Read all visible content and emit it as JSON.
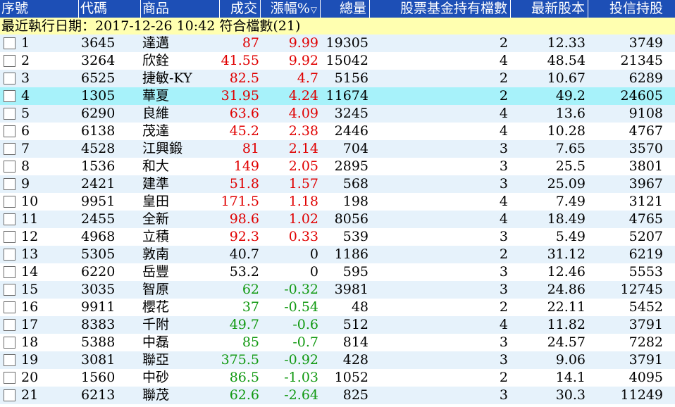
{
  "columns": {
    "seq": "序號",
    "code": "代碼",
    "name": "商品",
    "price": "成交",
    "change_pct": "漲幅%",
    "volume": "總量",
    "fund_count": "股票基金持有檔數",
    "shares": "最新股本",
    "trust_holding": "投信持股"
  },
  "sort_icon": "triangle-down-icon",
  "info_text": "最近執行日期：2017-12-26 10:42 符合檔數(21)",
  "selected_row": 4,
  "colors": {
    "header_bg": "#1d4fb6",
    "info_bg": "#ffffb0",
    "row_alt_bg": "#e6f2fb",
    "selected_bg": "#a7f2fa",
    "up": "#e00000",
    "down": "#119911"
  },
  "rows": [
    {
      "seq": "1",
      "code": "3645",
      "name": "達邁",
      "price": "87",
      "change": "9.99",
      "volume": "19305",
      "fund": "2",
      "shares": "12.33",
      "trust": "3749",
      "dir": "up"
    },
    {
      "seq": "2",
      "code": "3264",
      "name": "欣銓",
      "price": "41.55",
      "change": "9.92",
      "volume": "15042",
      "fund": "4",
      "shares": "48.54",
      "trust": "21345",
      "dir": "up"
    },
    {
      "seq": "3",
      "code": "6525",
      "name": "捷敏-KY",
      "price": "82.5",
      "change": "4.7",
      "volume": "5156",
      "fund": "2",
      "shares": "10.67",
      "trust": "6289",
      "dir": "up"
    },
    {
      "seq": "4",
      "code": "1305",
      "name": "華夏",
      "price": "31.95",
      "change": "4.24",
      "volume": "11674",
      "fund": "2",
      "shares": "49.2",
      "trust": "24605",
      "dir": "up"
    },
    {
      "seq": "5",
      "code": "6290",
      "name": "良維",
      "price": "63.6",
      "change": "4.09",
      "volume": "3245",
      "fund": "4",
      "shares": "13.6",
      "trust": "9108",
      "dir": "up"
    },
    {
      "seq": "6",
      "code": "6138",
      "name": "茂達",
      "price": "45.2",
      "change": "2.38",
      "volume": "2446",
      "fund": "4",
      "shares": "10.28",
      "trust": "4767",
      "dir": "up"
    },
    {
      "seq": "7",
      "code": "4528",
      "name": "江興鍛",
      "price": "81",
      "change": "2.14",
      "volume": "704",
      "fund": "3",
      "shares": "7.65",
      "trust": "3570",
      "dir": "up"
    },
    {
      "seq": "8",
      "code": "1536",
      "name": "和大",
      "price": "149",
      "change": "2.05",
      "volume": "2895",
      "fund": "3",
      "shares": "25.5",
      "trust": "3801",
      "dir": "up"
    },
    {
      "seq": "9",
      "code": "2421",
      "name": "建準",
      "price": "51.8",
      "change": "1.57",
      "volume": "568",
      "fund": "3",
      "shares": "25.09",
      "trust": "3967",
      "dir": "up"
    },
    {
      "seq": "10",
      "code": "9951",
      "name": "皇田",
      "price": "171.5",
      "change": "1.18",
      "volume": "198",
      "fund": "4",
      "shares": "7.49",
      "trust": "3121",
      "dir": "up"
    },
    {
      "seq": "11",
      "code": "2455",
      "name": "全新",
      "price": "98.6",
      "change": "1.02",
      "volume": "8056",
      "fund": "4",
      "shares": "18.49",
      "trust": "4765",
      "dir": "up"
    },
    {
      "seq": "12",
      "code": "4968",
      "name": "立積",
      "price": "92.3",
      "change": "0.33",
      "volume": "539",
      "fund": "3",
      "shares": "5.49",
      "trust": "5207",
      "dir": "up"
    },
    {
      "seq": "13",
      "code": "5305",
      "name": "敦南",
      "price": "40.7",
      "change": "0",
      "volume": "1186",
      "fund": "2",
      "shares": "31.12",
      "trust": "6219",
      "dir": "flat"
    },
    {
      "seq": "14",
      "code": "6220",
      "name": "岳豐",
      "price": "53.2",
      "change": "0",
      "volume": "595",
      "fund": "3",
      "shares": "12.46",
      "trust": "5553",
      "dir": "flat"
    },
    {
      "seq": "15",
      "code": "3035",
      "name": "智原",
      "price": "62",
      "change": "-0.32",
      "volume": "3981",
      "fund": "3",
      "shares": "24.86",
      "trust": "12745",
      "dir": "down"
    },
    {
      "seq": "16",
      "code": "9911",
      "name": "櫻花",
      "price": "37",
      "change": "-0.54",
      "volume": "48",
      "fund": "2",
      "shares": "22.11",
      "trust": "5452",
      "dir": "down"
    },
    {
      "seq": "17",
      "code": "8383",
      "name": "千附",
      "price": "49.7",
      "change": "-0.6",
      "volume": "512",
      "fund": "4",
      "shares": "11.82",
      "trust": "3791",
      "dir": "down"
    },
    {
      "seq": "18",
      "code": "5388",
      "name": "中磊",
      "price": "85",
      "change": "-0.7",
      "volume": "814",
      "fund": "3",
      "shares": "24.57",
      "trust": "7282",
      "dir": "down"
    },
    {
      "seq": "19",
      "code": "3081",
      "name": "聯亞",
      "price": "375.5",
      "change": "-0.92",
      "volume": "428",
      "fund": "3",
      "shares": "9.06",
      "trust": "3791",
      "dir": "down"
    },
    {
      "seq": "20",
      "code": "1560",
      "name": "中砂",
      "price": "86.5",
      "change": "-1.03",
      "volume": "1052",
      "fund": "2",
      "shares": "14.1",
      "trust": "4095",
      "dir": "down"
    },
    {
      "seq": "21",
      "code": "6213",
      "name": "聯茂",
      "price": "62.6",
      "change": "-2.64",
      "volume": "825",
      "fund": "3",
      "shares": "30.3",
      "trust": "11249",
      "dir": "down"
    }
  ]
}
